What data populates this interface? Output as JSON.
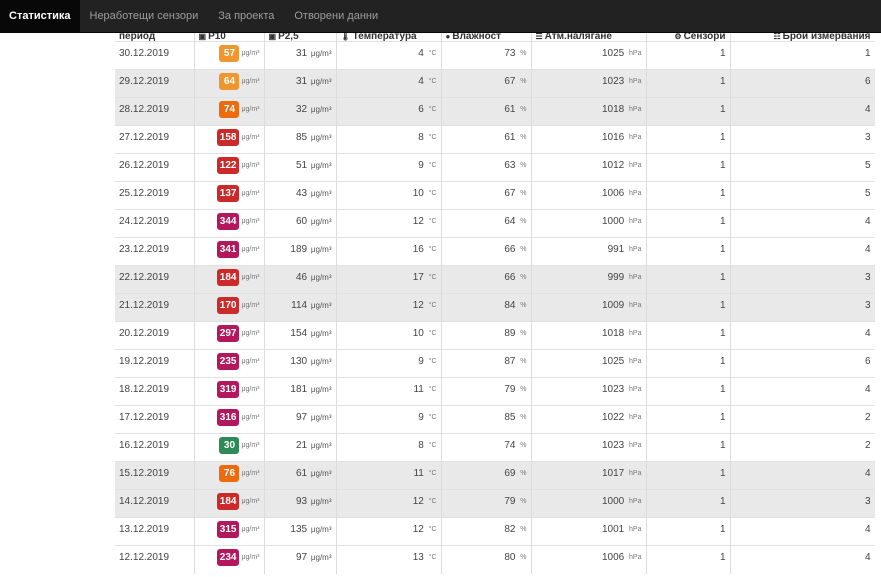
{
  "nav": {
    "items": [
      {
        "label": "Статистика",
        "active": true
      },
      {
        "label": "Неработещи сензори",
        "active": false
      },
      {
        "label": "За проекта",
        "active": false
      },
      {
        "label": "Отворени данни",
        "active": false
      }
    ]
  },
  "table": {
    "headers": {
      "period": "период",
      "p10": "P10",
      "p25": "P2,5",
      "temp": "Температура",
      "humidity": "Влажност",
      "pressure": "Атм.налягане",
      "sensors": "Сензори",
      "measurements": "Брой измервания"
    },
    "units": {
      "pm": "μg/m³",
      "temp": "°C",
      "humidity": "%",
      "pressure": "hPa"
    },
    "badge_colors": {
      "good": "#2e8b57",
      "moderate": "#f0962e",
      "elevated": "#ee6a0f",
      "high": "#cc2a2a",
      "very_high": "#b4185c"
    },
    "rows": [
      {
        "date": "30.12.2019",
        "p10": "57",
        "level": "moderate",
        "p25": "31",
        "temp": "4",
        "hum": "73",
        "pres": "1025",
        "sens": "1",
        "meas": "1",
        "shaded": false
      },
      {
        "date": "29.12.2019",
        "p10": "64",
        "level": "moderate",
        "p25": "31",
        "temp": "4",
        "hum": "67",
        "pres": "1023",
        "sens": "1",
        "meas": "6",
        "shaded": true
      },
      {
        "date": "28.12.2019",
        "p10": "74",
        "level": "elevated",
        "p25": "32",
        "temp": "6",
        "hum": "61",
        "pres": "1018",
        "sens": "1",
        "meas": "4",
        "shaded": true
      },
      {
        "date": "27.12.2019",
        "p10": "158",
        "level": "high",
        "p25": "85",
        "temp": "8",
        "hum": "61",
        "pres": "1016",
        "sens": "1",
        "meas": "3",
        "shaded": false
      },
      {
        "date": "26.12.2019",
        "p10": "122",
        "level": "high",
        "p25": "51",
        "temp": "9",
        "hum": "63",
        "pres": "1012",
        "sens": "1",
        "meas": "5",
        "shaded": false
      },
      {
        "date": "25.12.2019",
        "p10": "137",
        "level": "high",
        "p25": "43",
        "temp": "10",
        "hum": "67",
        "pres": "1006",
        "sens": "1",
        "meas": "5",
        "shaded": false
      },
      {
        "date": "24.12.2019",
        "p10": "344",
        "level": "very_high",
        "p25": "60",
        "temp": "12",
        "hum": "64",
        "pres": "1000",
        "sens": "1",
        "meas": "4",
        "shaded": false
      },
      {
        "date": "23.12.2019",
        "p10": "341",
        "level": "very_high",
        "p25": "189",
        "temp": "16",
        "hum": "66",
        "pres": "991",
        "sens": "1",
        "meas": "4",
        "shaded": false
      },
      {
        "date": "22.12.2019",
        "p10": "184",
        "level": "high",
        "p25": "46",
        "temp": "17",
        "hum": "66",
        "pres": "999",
        "sens": "1",
        "meas": "3",
        "shaded": true
      },
      {
        "date": "21.12.2019",
        "p10": "170",
        "level": "high",
        "p25": "114",
        "temp": "12",
        "hum": "84",
        "pres": "1009",
        "sens": "1",
        "meas": "3",
        "shaded": true
      },
      {
        "date": "20.12.2019",
        "p10": "297",
        "level": "very_high",
        "p25": "154",
        "temp": "10",
        "hum": "89",
        "pres": "1018",
        "sens": "1",
        "meas": "4",
        "shaded": false
      },
      {
        "date": "19.12.2019",
        "p10": "235",
        "level": "very_high",
        "p25": "130",
        "temp": "9",
        "hum": "87",
        "pres": "1025",
        "sens": "1",
        "meas": "6",
        "shaded": false
      },
      {
        "date": "18.12.2019",
        "p10": "319",
        "level": "very_high",
        "p25": "181",
        "temp": "11",
        "hum": "79",
        "pres": "1023",
        "sens": "1",
        "meas": "4",
        "shaded": false
      },
      {
        "date": "17.12.2019",
        "p10": "316",
        "level": "very_high",
        "p25": "97",
        "temp": "9",
        "hum": "85",
        "pres": "1022",
        "sens": "1",
        "meas": "2",
        "shaded": false
      },
      {
        "date": "16.12.2019",
        "p10": "30",
        "level": "good",
        "p25": "21",
        "temp": "8",
        "hum": "74",
        "pres": "1023",
        "sens": "1",
        "meas": "2",
        "shaded": false
      },
      {
        "date": "15.12.2019",
        "p10": "76",
        "level": "elevated",
        "p25": "61",
        "temp": "11",
        "hum": "69",
        "pres": "1017",
        "sens": "1",
        "meas": "4",
        "shaded": true
      },
      {
        "date": "14.12.2019",
        "p10": "184",
        "level": "high",
        "p25": "93",
        "temp": "12",
        "hum": "79",
        "pres": "1000",
        "sens": "1",
        "meas": "3",
        "shaded": true
      },
      {
        "date": "13.12.2019",
        "p10": "315",
        "level": "very_high",
        "p25": "135",
        "temp": "12",
        "hum": "82",
        "pres": "1001",
        "sens": "1",
        "meas": "4",
        "shaded": false
      },
      {
        "date": "12.12.2019",
        "p10": "234",
        "level": "very_high",
        "p25": "97",
        "temp": "13",
        "hum": "80",
        "pres": "1006",
        "sens": "1",
        "meas": "4",
        "shaded": false
      }
    ]
  }
}
